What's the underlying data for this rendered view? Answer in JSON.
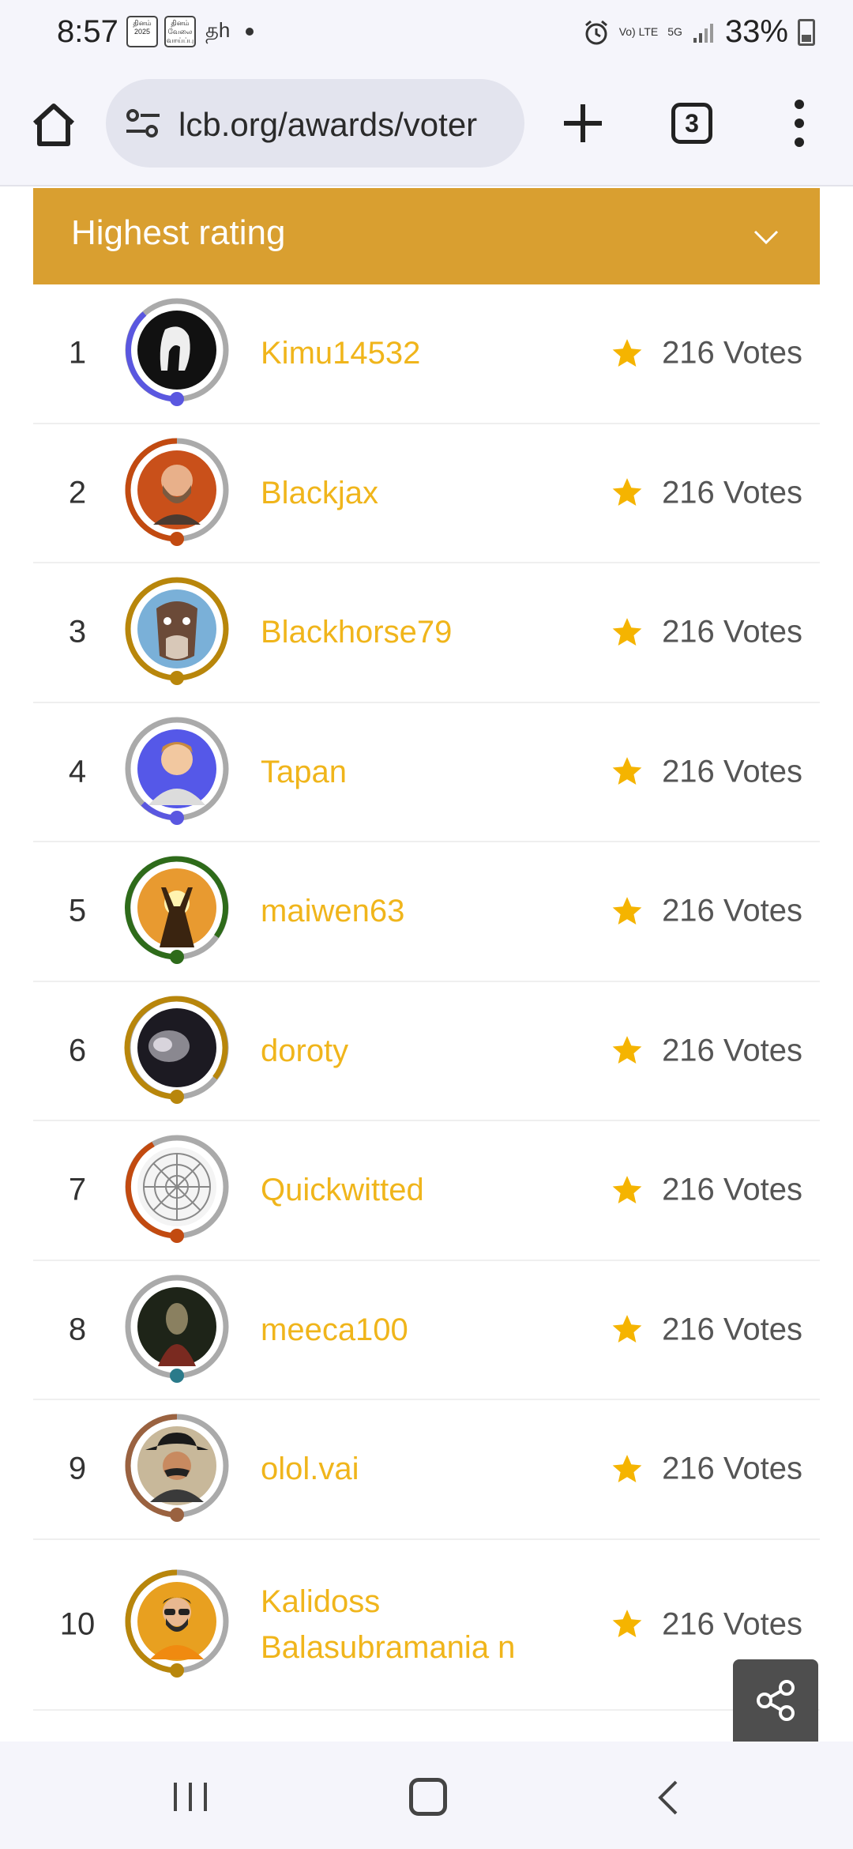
{
  "status": {
    "time": "8:57",
    "app_badge_1": "தினம் 2025",
    "app_badge_2": "தினம் வேலை வாய்ப்பு",
    "extra": "தh",
    "network_1": "Vo) LTE",
    "network_2": "5G",
    "battery": "33%"
  },
  "browser": {
    "url": "lcb.org/awards/voter",
    "tab_count": "3"
  },
  "sort": {
    "label": "Highest rating"
  },
  "leaderboard": [
    {
      "rank": "1",
      "name": "Kimu14532",
      "votes": "216 Votes",
      "ring_color": "#5a57e0",
      "avatar_desc": "dark-silhouette"
    },
    {
      "rank": "2",
      "name": "Blackjax",
      "votes": "216 Votes",
      "ring_color": "#c24a10",
      "avatar_desc": "bearded-man"
    },
    {
      "rank": "3",
      "name": "Blackhorse79",
      "votes": "216 Votes",
      "ring_color": "#b8860b",
      "avatar_desc": "horse-face"
    },
    {
      "rank": "4",
      "name": "Tapan",
      "votes": "216 Votes",
      "ring_color": "#5a57e0",
      "avatar_desc": "cartoon-man"
    },
    {
      "rank": "5",
      "name": "maiwen63",
      "votes": "216 Votes",
      "ring_color": "#2e6b1a",
      "avatar_desc": "sunset-arms"
    },
    {
      "rank": "6",
      "name": "doroty",
      "votes": "216 Votes",
      "ring_color": "#b8860b",
      "avatar_desc": "blurred-photo"
    },
    {
      "rank": "7",
      "name": "Quickwitted",
      "votes": "216 Votes",
      "ring_color": "#c24a10",
      "avatar_desc": "clock-web"
    },
    {
      "rank": "8",
      "name": "meeca100",
      "votes": "216 Votes",
      "ring_color": "#2a7a8a",
      "avatar_desc": "dark-figure"
    },
    {
      "rank": "9",
      "name": "olol.vai",
      "votes": "216 Votes",
      "ring_color": "#9a6240",
      "avatar_desc": "cowboy"
    },
    {
      "rank": "10",
      "name": "Kalidoss Balasubramania n",
      "votes": "216 Votes",
      "ring_color": "#b8860b",
      "avatar_desc": "bearded-glasses"
    }
  ],
  "colors": {
    "accent": "#d99f30",
    "username": "#f0b51b",
    "star": "#f5b400"
  }
}
